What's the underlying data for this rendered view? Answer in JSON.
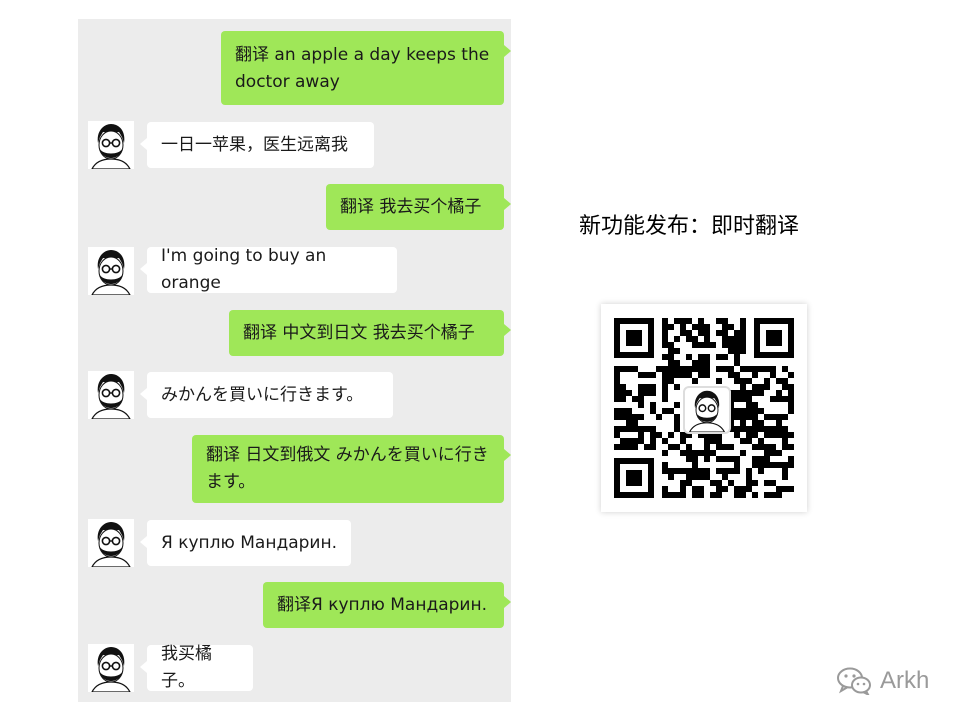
{
  "conversation": {
    "messages": [
      {
        "side": "me",
        "text": "翻译 an apple a day keeps the doctor away"
      },
      {
        "side": "them",
        "text": "一日一苹果，医生远离我"
      },
      {
        "side": "me",
        "text": "翻译 我去买个橘子"
      },
      {
        "side": "them",
        "text": "I'm going to buy an orange"
      },
      {
        "side": "me",
        "text": "翻译 中文到日文 我去买个橘子"
      },
      {
        "side": "them",
        "text": "みかんを買いに行きます。"
      },
      {
        "side": "me",
        "text": "翻译 日文到俄文 みかんを買いに行きます。"
      },
      {
        "side": "them",
        "text": "Я куплю Мандарин."
      },
      {
        "side": "me",
        "text": "翻译Я куплю Мандарин."
      },
      {
        "side": "them",
        "text": "我买橘子。"
      }
    ]
  },
  "promo": {
    "title": "新功能发布：即时翻译",
    "qr_icon": "qr-code"
  },
  "watermark": {
    "icon": "wechat-logo-icon",
    "text": "Arkh"
  },
  "colors": {
    "chat_background": "#ececec",
    "sent_bubble": "#9fe758",
    "received_bubble": "#ffffff",
    "watermark": "#9a9a9a"
  }
}
